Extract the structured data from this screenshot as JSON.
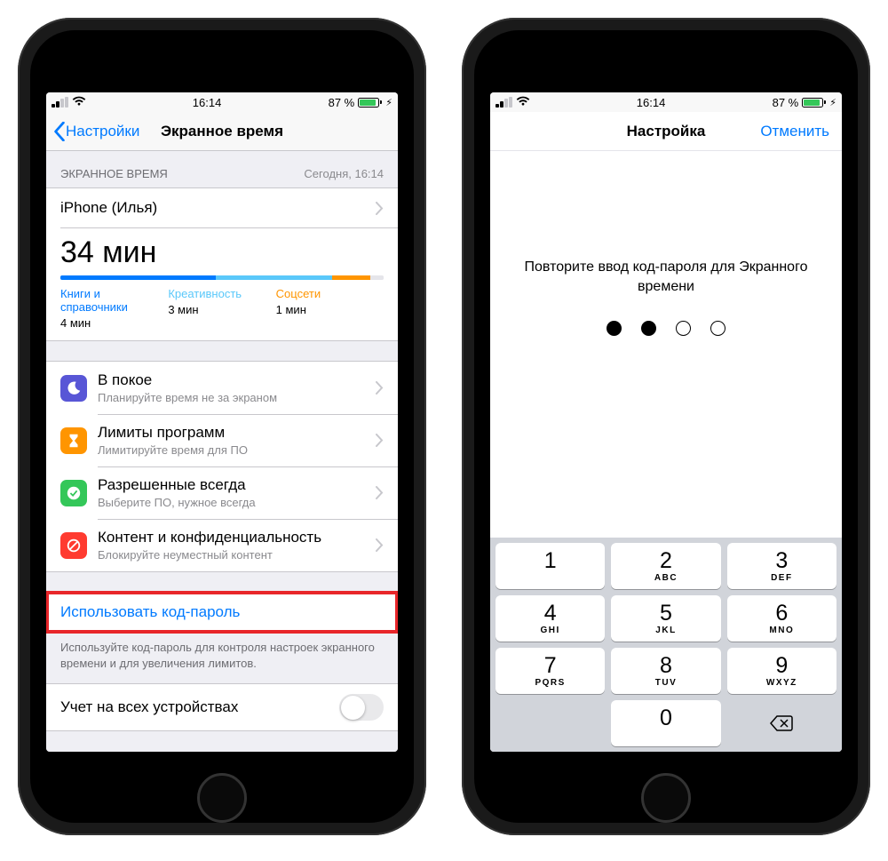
{
  "status": {
    "time": "16:14",
    "battery_pct": "87 %",
    "battery_fill": 87
  },
  "left": {
    "back": "Настройки",
    "title": "Экранное время",
    "section_header": "ЭКРАННОЕ ВРЕМЯ",
    "section_header_right": "Сегодня, 16:14",
    "device": "iPhone (Илья)",
    "total": "34 мин",
    "categories": [
      {
        "name": "Книги и справочники",
        "value": "4 мин",
        "color": "#007aff",
        "width": 48
      },
      {
        "name": "Креативность",
        "value": "3 мин",
        "color": "#5ac8fa",
        "width": 36
      },
      {
        "name": "Соцсети",
        "value": "1 мин",
        "color": "#ff9500",
        "width": 12
      }
    ],
    "items": [
      {
        "title": "В покое",
        "sub": "Планируйте время не за экраном",
        "icon_bg": "#5856d6",
        "icon": "moon"
      },
      {
        "title": "Лимиты программ",
        "sub": "Лимитируйте время для ПО",
        "icon_bg": "#ff9500",
        "icon": "hourglass"
      },
      {
        "title": "Разрешенные всегда",
        "sub": "Выберите ПО, нужное всегда",
        "icon_bg": "#34c759",
        "icon": "check"
      },
      {
        "title": "Контент и конфиденциальность",
        "sub": "Блокируйте неуместный контент",
        "icon_bg": "#ff3b30",
        "icon": "nosign"
      }
    ],
    "passcode_link": "Использовать код-пароль",
    "passcode_note": "Используйте код-пароль для контроля настроек экранного времени и для увеличения лимитов.",
    "share_row": "Учет на всех устройствах"
  },
  "right": {
    "title": "Настройка",
    "cancel": "Отменить",
    "prompt": "Повторите ввод код-пароля для Экранного времени",
    "dots_filled": 2,
    "keys": [
      {
        "n": "1",
        "l": ""
      },
      {
        "n": "2",
        "l": "ABC"
      },
      {
        "n": "3",
        "l": "DEF"
      },
      {
        "n": "4",
        "l": "GHI"
      },
      {
        "n": "5",
        "l": "JKL"
      },
      {
        "n": "6",
        "l": "MNO"
      },
      {
        "n": "7",
        "l": "PQRS"
      },
      {
        "n": "8",
        "l": "TUV"
      },
      {
        "n": "9",
        "l": "WXYZ"
      },
      {
        "n": "",
        "l": ""
      },
      {
        "n": "0",
        "l": ""
      },
      {
        "n": "⌫",
        "l": ""
      }
    ]
  }
}
